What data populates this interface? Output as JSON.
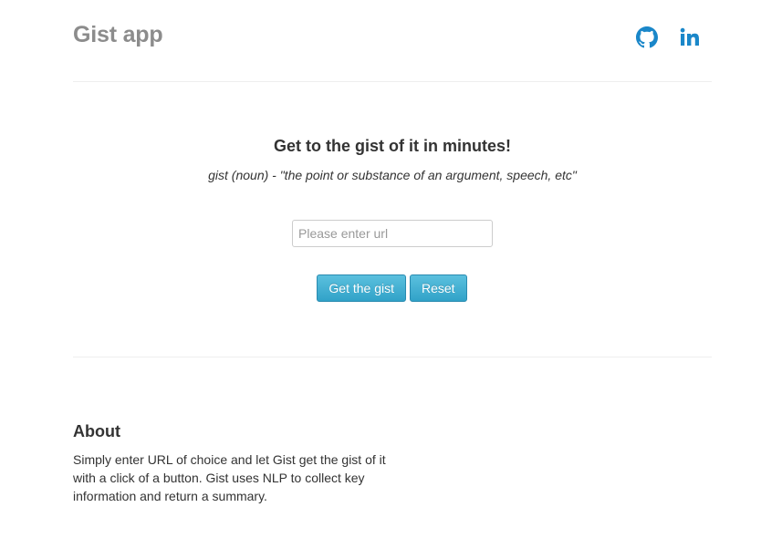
{
  "header": {
    "brand": "Gist app",
    "links": [
      {
        "icon": "github-icon",
        "label": "GitHub"
      },
      {
        "icon": "linkedin-icon",
        "label": "in"
      }
    ]
  },
  "hero": {
    "title": "Get to the gist of it in minutes!",
    "subtitle": "gist (noun) - \"the point or substance of an argument, speech, etc\""
  },
  "form": {
    "url_placeholder": "Please enter url",
    "url_value": "",
    "submit_label": "Get the gist",
    "reset_label": "Reset"
  },
  "about": {
    "title": "About",
    "text": "Simply enter URL of choice and let Gist get the gist of it with a click of a button. Gist uses NLP to collect key information and return a summary."
  },
  "colors": {
    "accent": "#5bc0de",
    "icon_blue": "#1a87c9",
    "brand_gray": "#8c8c8c"
  }
}
